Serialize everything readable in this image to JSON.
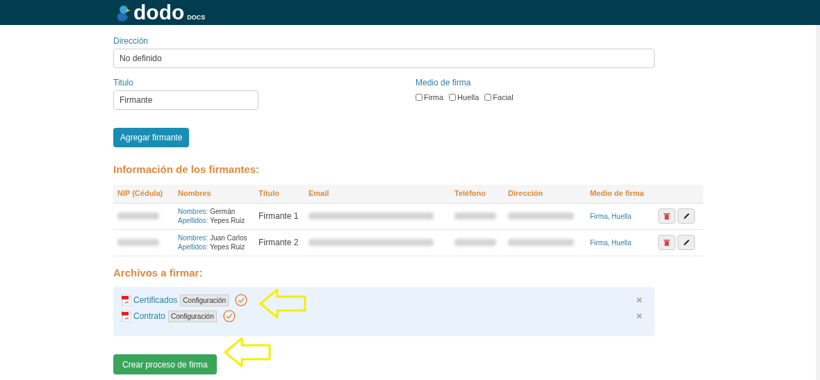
{
  "header": {
    "logo_text": "dodo",
    "logo_sub": "DOCS"
  },
  "form": {
    "direccion": {
      "label": "Dirección",
      "value": "No definido"
    },
    "titulo": {
      "label": "Titulo",
      "value": "Firmante"
    },
    "medio": {
      "label": "Medio de firma",
      "options": [
        {
          "label": "Firma",
          "checked": false
        },
        {
          "label": "Huella",
          "checked": false
        },
        {
          "label": "Facial",
          "checked": false
        }
      ]
    },
    "add_button": "Agregar firmante"
  },
  "signers": {
    "heading": "Información de los firmantes:",
    "columns": [
      {
        "label": "NIP (Cédula)",
        "redacted": true
      },
      {
        "label": "Nombres",
        "redacted": false
      },
      {
        "label": "Título",
        "redacted": false
      },
      {
        "label": "Email",
        "redacted": true
      },
      {
        "label": "Teléfono",
        "redacted": true
      },
      {
        "label": "Dirección",
        "redacted": true
      },
      {
        "label": "Medio de firma",
        "redacted": false
      }
    ],
    "rows": [
      {
        "nombres_label": "Nombres:",
        "nombres": "Germán",
        "apellidos_label": "Apellidos:",
        "apellidos": "Yepes Ruiz",
        "titulo": "Firmante 1",
        "medio": "Firma, Huella"
      },
      {
        "nombres_label": "Nombres:",
        "nombres": "Juan Carlos",
        "apellidos_label": "Apellidos:",
        "apellidos": "Yepes Ruiz",
        "titulo": "Firmante 2",
        "medio": "Firma, Huella"
      }
    ]
  },
  "files": {
    "heading": "Archivos a firmar:",
    "items": [
      {
        "name": "Certificados",
        "config": "Configuración"
      },
      {
        "name": "Contrato",
        "config": "Configuración"
      }
    ]
  },
  "submit": "Crear proceso de firma"
}
